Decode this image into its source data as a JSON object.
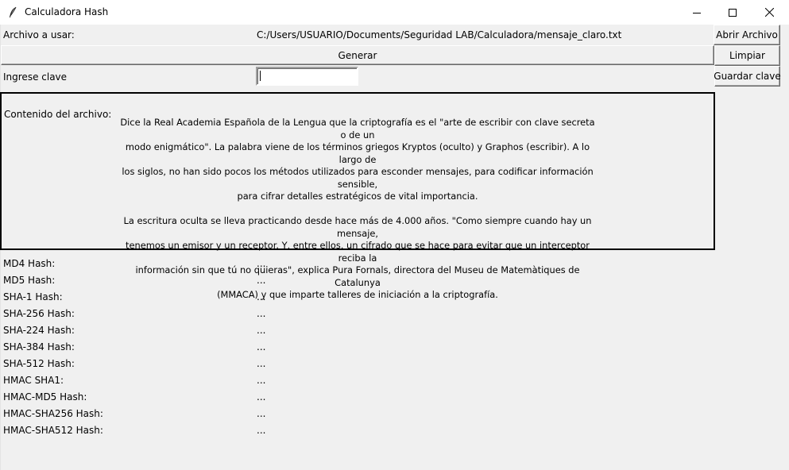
{
  "window": {
    "title": "Calculadora Hash",
    "app_icon": "feather-icon",
    "controls": [
      "minimize-icon",
      "maximize-icon",
      "close-icon"
    ]
  },
  "file": {
    "label": "Archivo a usar:",
    "path": "C:/Users/USUARIO/Documents/Seguridad LAB/Calculadora/mensaje_claro.txt",
    "open_button": "Abrir Archivo"
  },
  "generate_button": "Generar",
  "clear_button": "Limpiar",
  "key": {
    "label": "Ingrese clave",
    "value": "",
    "save_button": "Guardar clave"
  },
  "content": {
    "label": "Contenido del archivo:",
    "text": "Dice la Real Academia Española de la Lengua que la criptografía es el \"arte de escribir con clave secreta o de un\nmodo enigmático\". La palabra viene de los términos griegos Kryptos (oculto) y Graphos (escribir). A lo largo de\nlos siglos, no han sido pocos los métodos utilizados para esconder mensajes, para codificar información sensible,\npara cifrar detalles estratégicos de vital importancia.\n\nLa escritura oculta se lleva practicando desde hace más de 4.000 años. \"Como siempre cuando hay un mensaje,\ntenemos un emisor y un receptor. Y, entre ellos, un cifrado que se hace para evitar que un interceptor reciba la\ninformación sin que tú no quieras\", explica Pura Fornals, directora del Museu de Matemàtiques de Catalunya\n(MMACA) y que imparte talleres de iniciación a la criptografía."
  },
  "hashes": [
    {
      "label": "MD4 Hash:",
      "value": "..."
    },
    {
      "label": "MD5 Hash:",
      "value": "..."
    },
    {
      "label": "SHA-1 Hash:",
      "value": "..."
    },
    {
      "label": "SHA-256 Hash:",
      "value": "..."
    },
    {
      "label": "SHA-224 Hash:",
      "value": "..."
    },
    {
      "label": "SHA-384 Hash:",
      "value": "..."
    },
    {
      "label": "SHA-512 Hash:",
      "value": "..."
    },
    {
      "label": "HMAC SHA1:",
      "value": "..."
    },
    {
      "label": "HMAC-MD5 Hash:",
      "value": "..."
    },
    {
      "label": "HMAC-SHA256 Hash:",
      "value": "..."
    },
    {
      "label": "HMAC-SHA512 Hash:",
      "value": "..."
    }
  ]
}
